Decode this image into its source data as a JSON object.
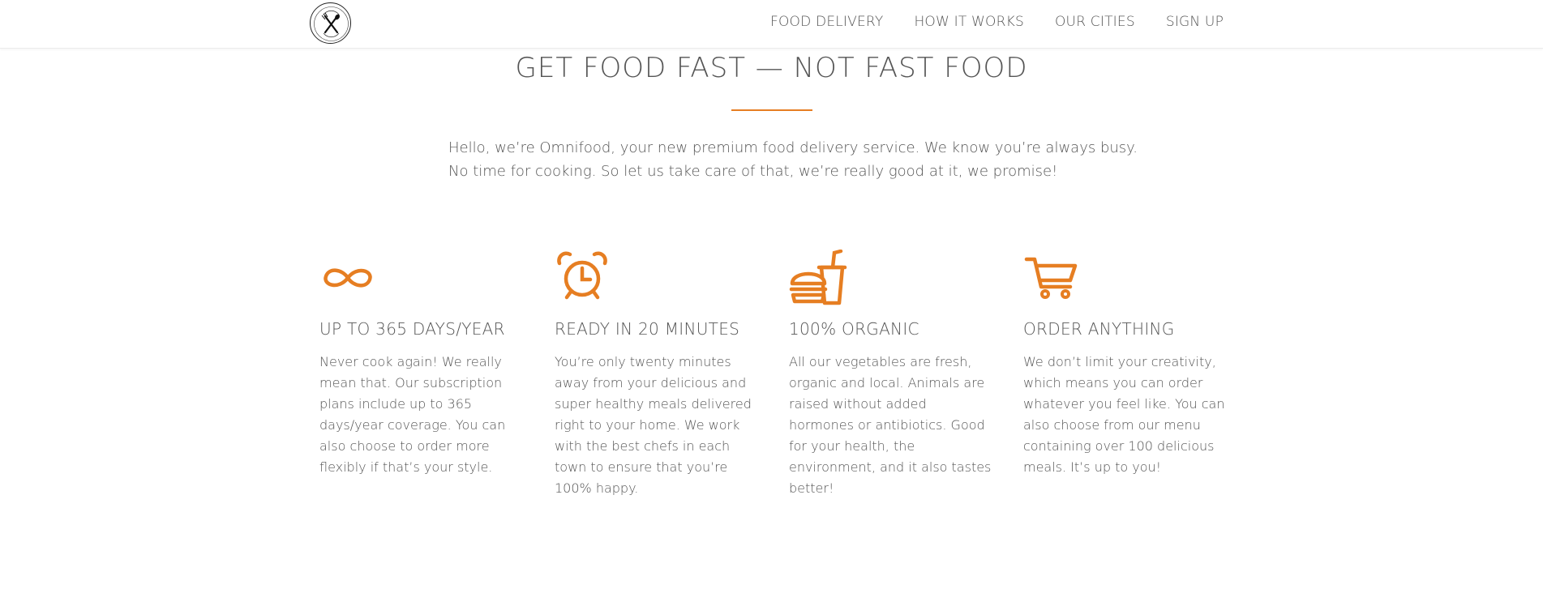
{
  "nav": {
    "logo": {
      "alt": "Omnifood logo"
    },
    "items": [
      {
        "label": "FOOD DELIVERY"
      },
      {
        "label": "HOW IT WORKS"
      },
      {
        "label": "OUR CITIES"
      },
      {
        "label": "SIGN UP"
      }
    ]
  },
  "section": {
    "title": "GET FOOD FAST — NOT FAST FOOD",
    "intro_line1": "Hello, we’re Omnifood, your new premium food delivery service. We know you’re always busy.",
    "intro_line2": "No time for cooking. So let us take care of that, we’re really good at it, we promise!"
  },
  "features": [
    {
      "icon": "infinity-icon",
      "title": "UP TO 365 DAYS/YEAR",
      "text": "Never cook again! We really mean that. Our subscription plans include up to 365 days/year coverage. You can also choose to order more flexibly if that’s your style."
    },
    {
      "icon": "alarm-clock-icon",
      "title": "READY IN 20 MINUTES",
      "text": "You’re only twenty minutes away from your delicious and super healthy meals delivered right to your home. We work with the best chefs in each town to ensure that you’re 100% happy."
    },
    {
      "icon": "burger-drink-icon",
      "title": "100% ORGANIC",
      "text": "All our vegetables are fresh, organic and local. Animals are raised without added hormones or antibiotics. Good for your health, the environment, and it also tastes better!"
    },
    {
      "icon": "shopping-cart-icon",
      "title": "ORDER ANYTHING",
      "text": "We don’t limit your creativity, which means you can order whatever you feel like. You can also choose from our menu containing over 100 delicious meals. It’s up to you!"
    }
  ],
  "colors": {
    "accent": "#e67e22",
    "text": "#555555"
  }
}
